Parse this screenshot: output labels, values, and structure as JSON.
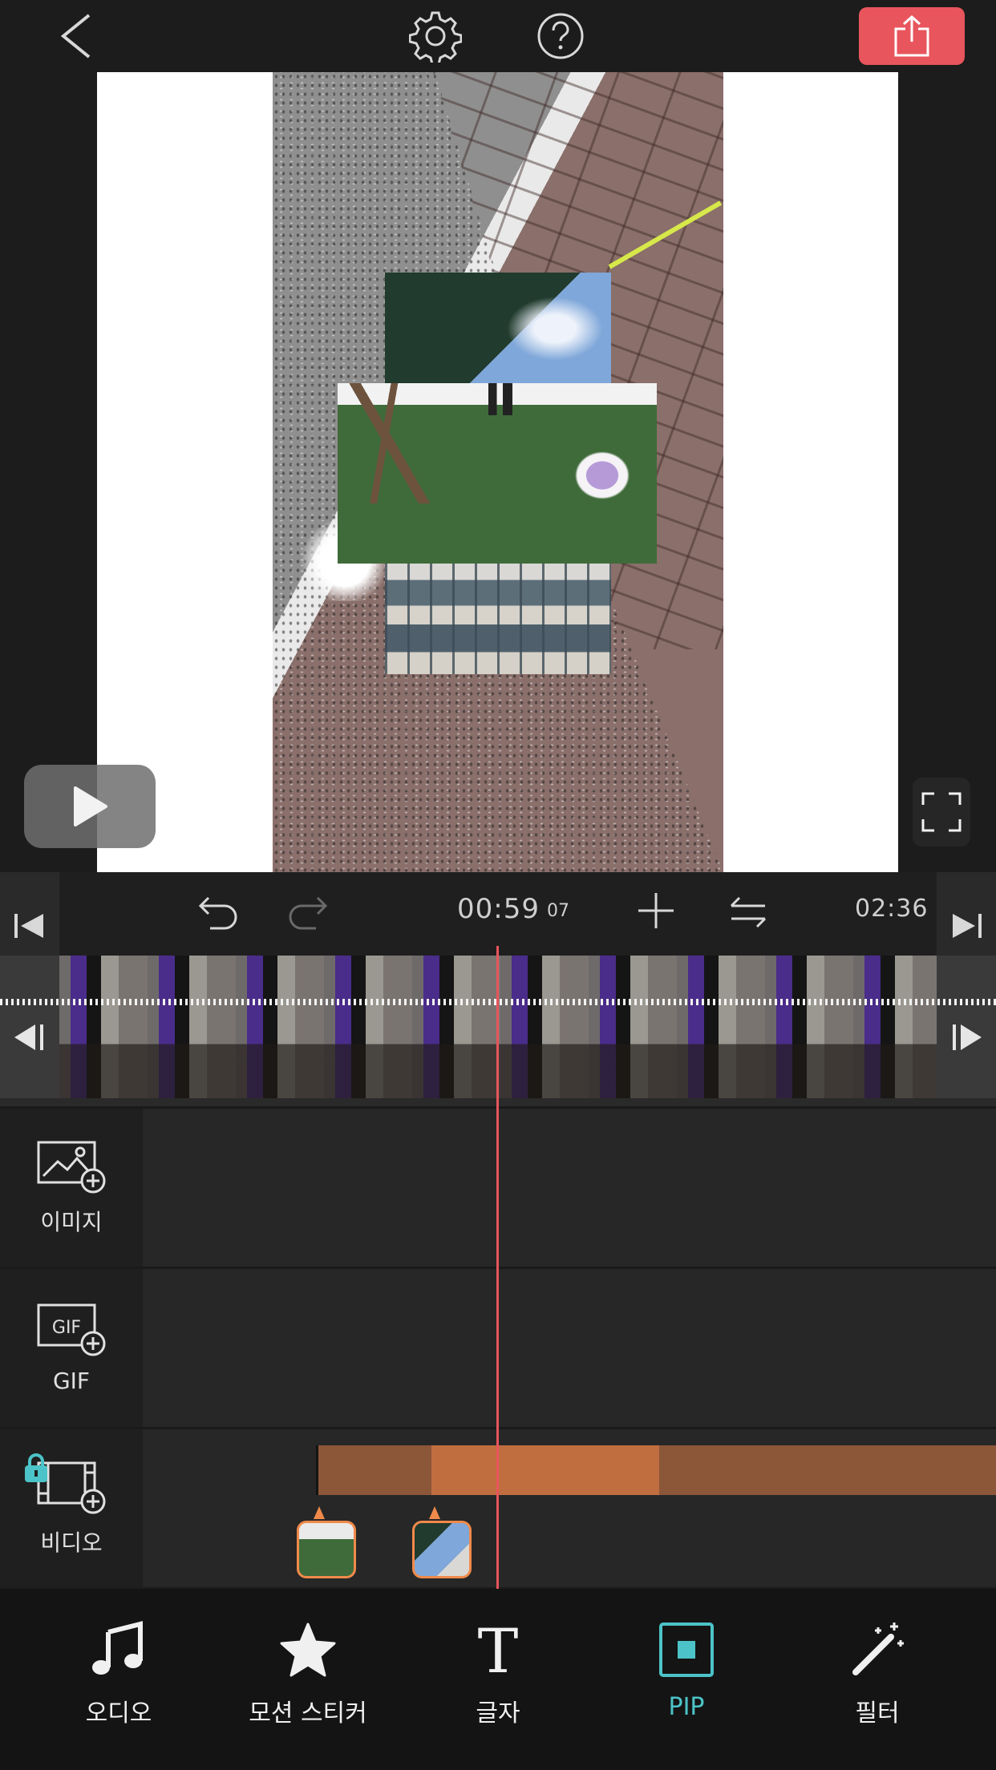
{
  "toolbar": {
    "back_icon": "chevron-left-icon",
    "settings_icon": "gear-icon",
    "help_icon": "question-circle-icon",
    "export_icon": "share-export-icon",
    "accent_color": "#e8555c"
  },
  "preview": {
    "play_icon": "play-icon",
    "fullscreen_icon": "fullscreen-icon"
  },
  "timeline": {
    "current_time": "00:59",
    "current_frame": "07",
    "total_time": "02:36",
    "playhead_color": "#e8555c"
  },
  "tracks": {
    "image_label": "이미지",
    "gif_label": "GIF",
    "gif_icon_text": "GIF",
    "video_label": "비디오",
    "clip_color": "#c06e40"
  },
  "bottom_tools": {
    "audio": "오디오",
    "sticker": "모션 스티커",
    "text": "글자",
    "text_icon_glyph": "T",
    "pip": "PIP",
    "filter": "필터",
    "active_tool": "PIP",
    "active_color": "#4cc3c8"
  }
}
